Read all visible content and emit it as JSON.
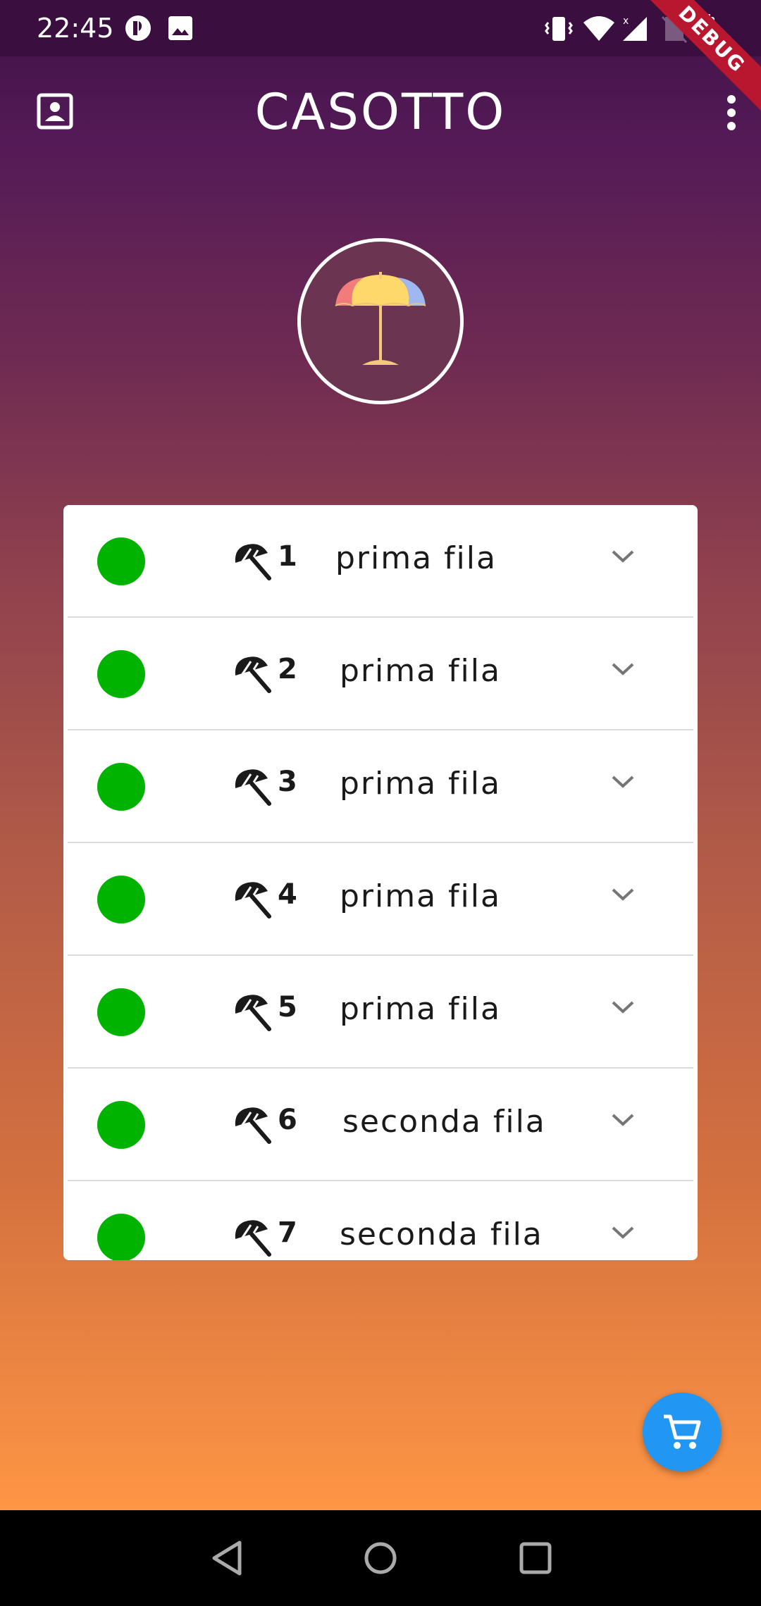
{
  "status_bar": {
    "time": "22:45",
    "debug_label": "DEBUG",
    "icons": [
      "notification-icon",
      "image-icon",
      "vibrate-icon",
      "wifi-icon",
      "signal-icon",
      "no-sim-icon",
      "battery-icon"
    ]
  },
  "app_bar": {
    "title": "CASOTTO",
    "left_icon": "contact-card-icon",
    "right_icon": "more-vert-icon"
  },
  "avatar": {
    "icon": "beach-umbrella-icon"
  },
  "list": {
    "rows": [
      {
        "number": "1",
        "label": "prima fila",
        "status_color": "#00b300"
      },
      {
        "number": "2",
        "label": "prima fila",
        "status_color": "#00b300"
      },
      {
        "number": "3",
        "label": "prima fila",
        "status_color": "#00b300"
      },
      {
        "number": "4",
        "label": "prima fila",
        "status_color": "#00b300"
      },
      {
        "number": "5",
        "label": "prima fila",
        "status_color": "#00b300"
      },
      {
        "number": "6",
        "label": "seconda fila",
        "status_color": "#00b300"
      },
      {
        "number": "7",
        "label": "seconda fila",
        "status_color": "#00b300"
      }
    ]
  },
  "fab": {
    "icon": "shopping-cart-icon",
    "color": "#2196f3"
  },
  "nav_bar": {
    "icons": [
      "back-icon",
      "home-icon",
      "recents-icon"
    ]
  },
  "colors": {
    "gradient_top": "#3e1245",
    "gradient_bottom": "#ff9645",
    "status_available": "#00b300"
  }
}
